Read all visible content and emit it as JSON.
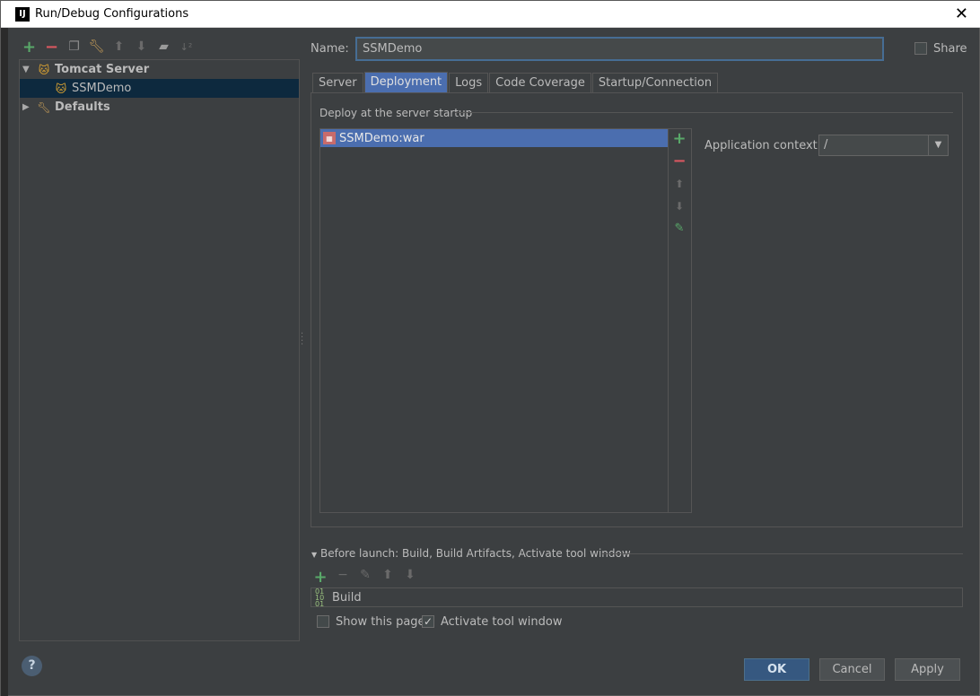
{
  "window": {
    "title": "Run/Debug Configurations",
    "app_icon": "IJ"
  },
  "toolbar": {
    "icons": [
      "add-icon",
      "remove-icon",
      "copy-icon",
      "wrench-icon",
      "move-up-icon",
      "move-down-icon",
      "folder-icon",
      "sort-icon"
    ]
  },
  "tree": {
    "tomcat_label": "Tomcat Server",
    "item_label": "SSMDemo",
    "defaults_label": "Defaults"
  },
  "name_field": {
    "label": "Name:",
    "value": "SSMDemo"
  },
  "share": {
    "label": "Share",
    "checked": false
  },
  "tabs": [
    "Server",
    "Deployment",
    "Logs",
    "Code Coverage",
    "Startup/Connection"
  ],
  "active_tab": "Deployment",
  "deployment": {
    "section_title": "Deploy at the server startup",
    "artifact": "SSMDemo:war",
    "context_label": "Application context:",
    "context_value": "/"
  },
  "before_launch": {
    "title": "Before launch: Build, Build Artifacts, Activate tool window",
    "task": "Build"
  },
  "options": {
    "show_page_label": "Show this page",
    "show_page_checked": false,
    "activate_label": "Activate tool window",
    "activate_checked": true
  },
  "buttons": {
    "help": "?",
    "ok": "OK",
    "cancel": "Cancel",
    "apply": "Apply"
  }
}
